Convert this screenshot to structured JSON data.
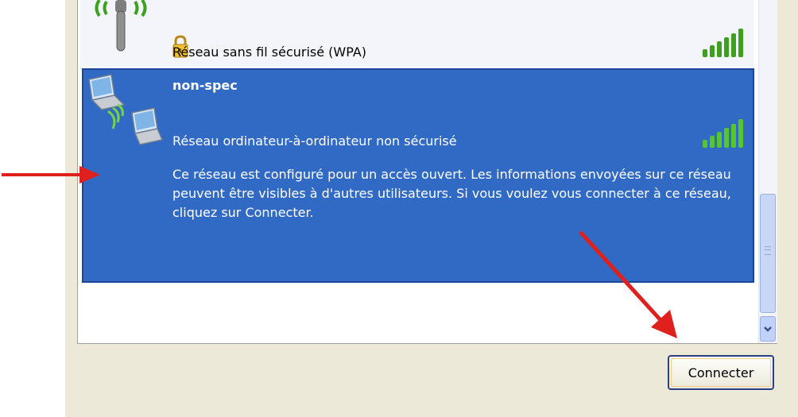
{
  "network_list": {
    "items": [
      {
        "name": "",
        "status": "Réseau sans fil sécurisé (WPA)",
        "signal_icon": "signal-strength-icon",
        "lock_icon": "lock-icon",
        "network_icon": "wireless-antenna-icon"
      },
      {
        "name": "non-spec",
        "status": "Réseau ordinateur-à-ordinateur non sécurisé",
        "description": "Ce réseau est configuré pour un accès ouvert. Les informations envoyées sur ce réseau peuvent être visibles à d'autres utilisateurs. Si vous voulez vous connecter à ce réseau, cliquez sur Connecter.",
        "signal_icon": "signal-strength-icon",
        "network_icon": "computer-to-computer-icon",
        "selected": true
      }
    ]
  },
  "buttons": {
    "connect_label": "Connecter"
  },
  "colors": {
    "selection": "#316ac5",
    "signal_green": "#3da11e",
    "annotation_red": "#e0201c"
  }
}
